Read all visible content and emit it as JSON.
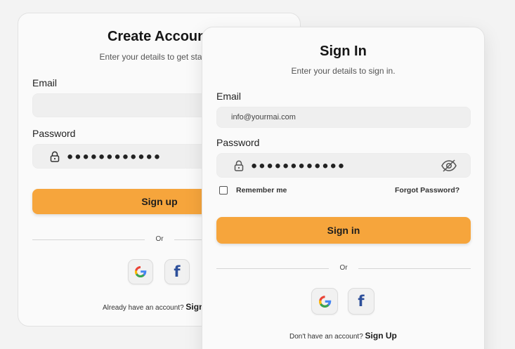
{
  "create_account": {
    "title": "Create Account",
    "subtitle": "Enter your details to get started.",
    "email_label": "Email",
    "email_value": "",
    "password_label": "Password",
    "password_mask": "●●●●●●●●●●●●",
    "signup_button": "Sign up",
    "divider_text": "Or",
    "footer_text": "Already have an account?",
    "footer_link": "Sign In"
  },
  "sign_in": {
    "title": "Sign In",
    "subtitle": "Enter your details to sign in.",
    "email_label": "Email",
    "email_value": "info@yourmai.com",
    "password_label": "Password",
    "password_mask": "●●●●●●●●●●●●",
    "remember_label": "Remember me",
    "forgot_link": "Forgot Password?",
    "signin_button": "Sign in",
    "divider_text": "Or",
    "footer_text": "Don't have an account?",
    "footer_link": "Sign Up"
  },
  "icons": {
    "lock": "lock-icon",
    "eye_hidden": "eye-off-icon",
    "google": "google-icon",
    "facebook": "facebook-icon"
  },
  "colors": {
    "accent": "#f6a53c",
    "facebook": "#2d4f9a"
  }
}
